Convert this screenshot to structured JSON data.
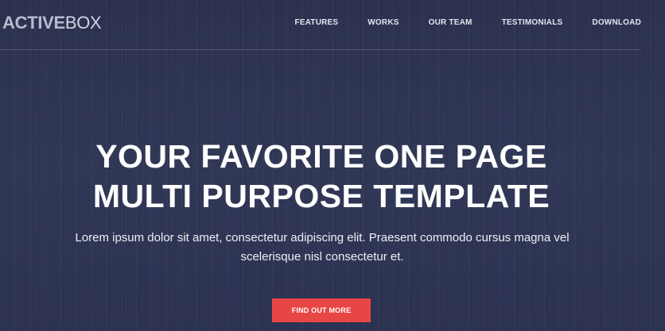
{
  "header": {
    "logo_strong": "ACTIVE",
    "logo_light": "BOX",
    "nav": [
      {
        "label": "FEATURES"
      },
      {
        "label": "WORKS"
      },
      {
        "label": "OUR TEAM"
      },
      {
        "label": "TESTIMONIALS"
      },
      {
        "label": "DOWNLOAD"
      }
    ]
  },
  "hero": {
    "headline_line1": "YOUR FAVORITE ONE PAGE",
    "headline_line2": "MULTI PURPOSE TEMPLATE",
    "subtext": "Lorem ipsum dolor sit amet, consectetur adipiscing elit. Praesent commodo cursus magna vel scelerisque nisl consectetur et.",
    "cta_label": "FIND OUT MORE"
  },
  "colors": {
    "background": "#2f3553",
    "accent": "#e84545",
    "text": "#ffffff"
  }
}
